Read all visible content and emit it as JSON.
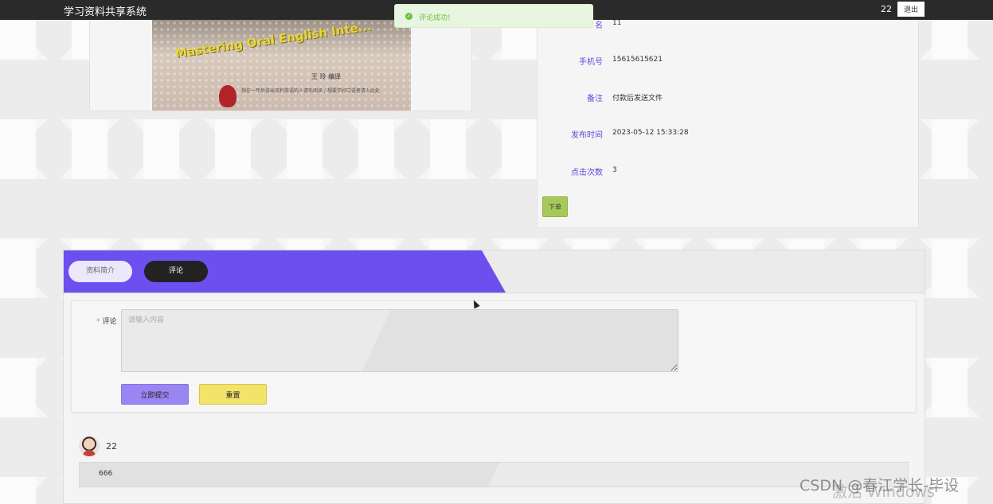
{
  "header": {
    "app_title": "学习资料共享系统",
    "username": "22",
    "logout_label": "退出"
  },
  "toast": {
    "message": "评论成功!"
  },
  "book_cover": {
    "english_title": "Mastering Oral English Inte...",
    "author": "王  玲  编译",
    "fine_print": "想在一年后说出流利英语的人请先阅读 / 想要学好口语者请入此处"
  },
  "info": {
    "rows": [
      {
        "key": "名",
        "value": "11"
      },
      {
        "key": "手机号",
        "value": "15615615621"
      },
      {
        "key": "备注",
        "value": "付款后发送文件"
      },
      {
        "key": "发布时间",
        "value": "2023-05-12 15:33:28"
      },
      {
        "key": "点击次数",
        "value": "3"
      }
    ],
    "order_label": "下单"
  },
  "tabs": {
    "intro_label": "资料简介",
    "comment_label": "评论"
  },
  "form": {
    "required_mark": "*",
    "comment_label": "评论",
    "comment_placeholder": "请输入内容",
    "submit_label": "立即提交",
    "reset_label": "重置"
  },
  "comments": [
    {
      "user": "22",
      "content": "666"
    }
  ],
  "overlays": {
    "activate_windows": "激活 Windows",
    "csdn_watermark": "CSDN @春江学长-毕设"
  },
  "colors": {
    "accent_purple": "#6d4ff0",
    "topbar": "#2a2a2a",
    "order_button": "#a6c95a",
    "submit_button": "#9a86f2",
    "reset_button": "#f2e36a",
    "success": "#67c23a"
  }
}
